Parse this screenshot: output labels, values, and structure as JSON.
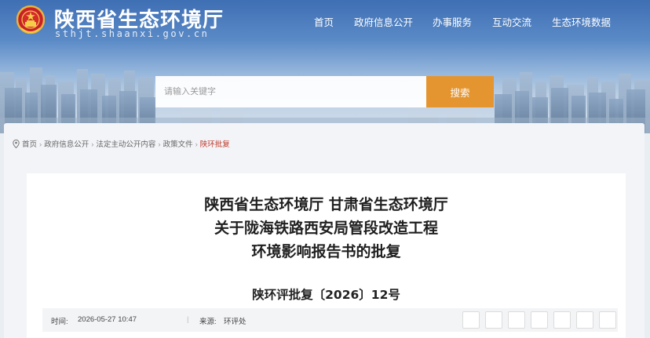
{
  "site": {
    "title": "陕西省生态环境厅",
    "domain": "sthjt.shaanxi.gov.cn"
  },
  "nav": [
    {
      "label": "首页"
    },
    {
      "label": "政府信息公开"
    },
    {
      "label": "办事服务"
    },
    {
      "label": "互动交流"
    },
    {
      "label": "生态环境数据"
    }
  ],
  "search": {
    "placeholder": "请输入关键字",
    "value": "",
    "button_label": "搜索"
  },
  "breadcrumb": [
    {
      "label": "首页"
    },
    {
      "label": "政府信息公开"
    },
    {
      "label": "法定主动公开内容"
    },
    {
      "label": "政策文件"
    },
    {
      "label": "陕环批复"
    }
  ],
  "breadcrumb_separator": "›",
  "article": {
    "title_lines": [
      "陕西省生态环境厅 甘肃省生态环境厅",
      "关于陇海铁路西安局管段改造工程",
      "环境影响报告书的批复"
    ],
    "doc_number": "陕环评批复〔2026〕12号",
    "meta": {
      "time_label": "时间:",
      "time_value": "2026-05-27 10:47",
      "divider": "|",
      "source_label": "来源:",
      "source_value": "环评处"
    }
  },
  "colors": {
    "search_button": "#e5952f",
    "breadcrumb_current": "#c0392b",
    "header_blue": "#3f6fb4"
  },
  "icons": [
    "national-emblem-icon",
    "location-pin-icon"
  ]
}
